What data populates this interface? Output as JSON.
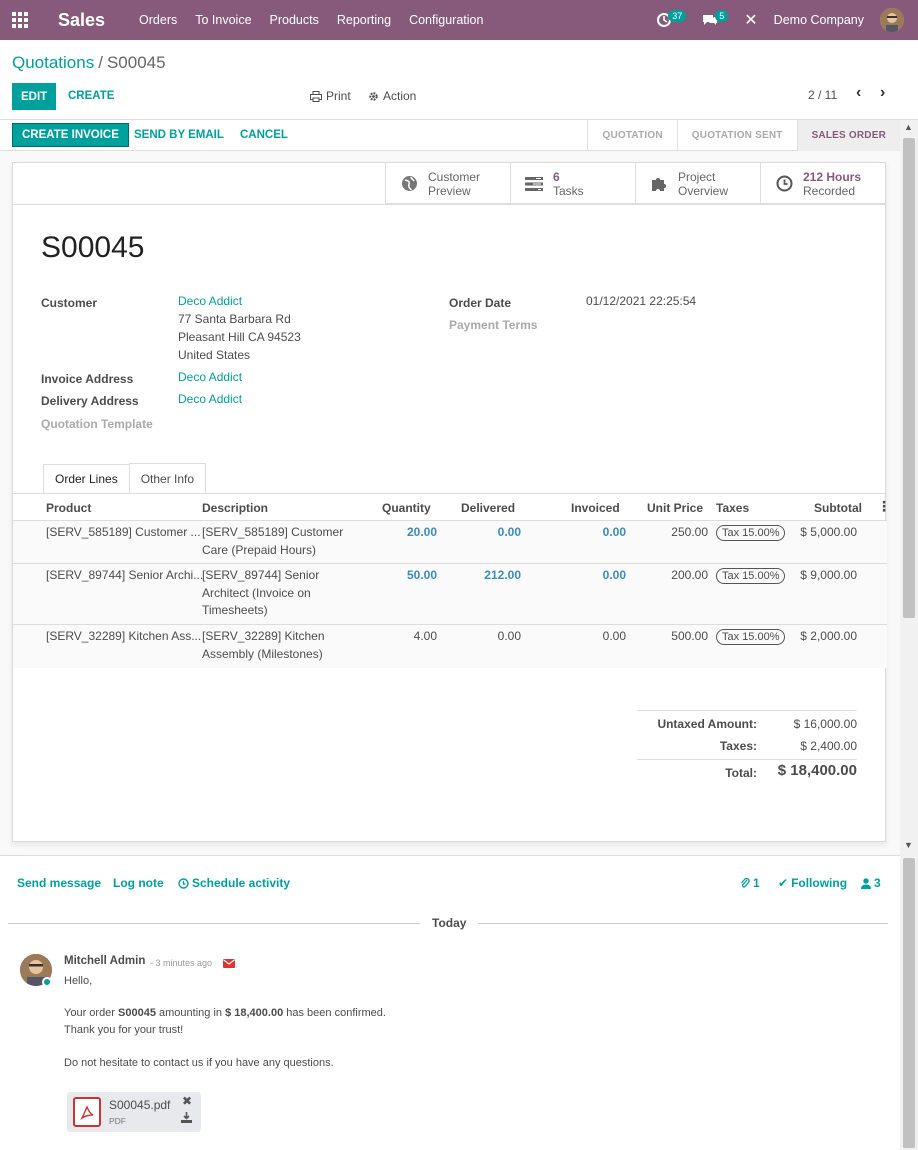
{
  "topbar": {
    "app_name": "Sales",
    "menu": [
      "Orders",
      "To Invoice",
      "Products",
      "Reporting",
      "Configuration"
    ],
    "activity_count": "37",
    "message_count": "5",
    "company": "Demo Company",
    "color": "#875a7b"
  },
  "control_panel": {
    "breadcrumb_parent": "Quotations",
    "breadcrumb_sep": "/",
    "breadcrumb_current": "S00045",
    "edit_label": "EDIT",
    "create_label": "CREATE",
    "print_label": "Print",
    "action_label": "Action",
    "pager": "2 / 11"
  },
  "statusbar": {
    "create_invoice": "CREATE INVOICE",
    "send_by_email": "SEND BY EMAIL",
    "cancel": "CANCEL",
    "stages": [
      "QUOTATION",
      "QUOTATION SENT",
      "SALES ORDER"
    ],
    "active_stage": "SALES ORDER"
  },
  "smart_buttons": [
    {
      "icon": "globe-icon",
      "line1": "Customer",
      "line2": "Preview"
    },
    {
      "icon": "tasks-icon",
      "line1": "6",
      "line2": "Tasks"
    },
    {
      "icon": "puzzle-icon",
      "line1": "Project",
      "line2": "Overview"
    },
    {
      "icon": "clock-icon",
      "line1": "212 Hours",
      "line2": "Recorded"
    }
  ],
  "form": {
    "name": "S00045",
    "customer_label": "Customer",
    "customer_name": "Deco Addict",
    "customer_address": [
      "77 Santa Barbara Rd",
      "Pleasant Hill CA 94523",
      "United States"
    ],
    "invoice_address_label": "Invoice Address",
    "invoice_address": "Deco Addict",
    "delivery_address_label": "Delivery Address",
    "delivery_address": "Deco Addict",
    "quotation_template_label": "Quotation Template",
    "order_date_label": "Order Date",
    "order_date": "01/12/2021 22:25:54",
    "payment_terms_label": "Payment Terms"
  },
  "tabs": [
    "Order Lines",
    "Other Info"
  ],
  "order_lines": {
    "columns": [
      "Product",
      "Description",
      "Quantity",
      "Delivered",
      "Invoiced",
      "Unit Price",
      "Taxes",
      "Subtotal"
    ],
    "rows": [
      {
        "product": "[SERV_585189] Customer ...",
        "description": [
          "[SERV_585189] Customer",
          "Care (Prepaid Hours)"
        ],
        "quantity": "20.00",
        "delivered": "0.00",
        "invoiced": "0.00",
        "unit_price": "250.00",
        "tax": "Tax 15.00%",
        "subtotal": "$ 5,000.00"
      },
      {
        "product": "[SERV_89744] Senior Archi...",
        "description": [
          "[SERV_89744] Senior",
          "Architect (Invoice on",
          "Timesheets)"
        ],
        "quantity": "50.00",
        "delivered": "212.00",
        "invoiced": "0.00",
        "unit_price": "200.00",
        "tax": "Tax 15.00%",
        "subtotal": "$ 9,000.00"
      },
      {
        "product": "[SERV_32289] Kitchen Ass...",
        "description": [
          "[SERV_32289] Kitchen",
          "Assembly (Milestones)"
        ],
        "quantity": "4.00",
        "delivered": "0.00",
        "invoiced": "0.00",
        "unit_price": "500.00",
        "tax": "Tax 15.00%",
        "subtotal": "$ 2,000.00"
      }
    ]
  },
  "totals": {
    "untaxed_label": "Untaxed Amount:",
    "untaxed": "$ 16,000.00",
    "taxes_label": "Taxes:",
    "taxes": "$ 2,400.00",
    "total_label": "Total:",
    "total": "$ 18,400.00"
  },
  "chatter": {
    "send_message": "Send message",
    "log_note": "Log note",
    "schedule_activity": "Schedule activity",
    "attachments_count": "1",
    "following": "Following",
    "followers_count": "3",
    "today": "Today",
    "message": {
      "author": "Mitchell Admin",
      "time": "- 3 minutes ago",
      "hello": "Hello,",
      "line1_pre": "Your order ",
      "line1_order": "S00045",
      "line1_mid": " amounting in ",
      "line1_amount": "$ 18,400.00",
      "line1_post": " has been confirmed.",
      "line2": "Thank you for your trust!",
      "line3": "Do not hesitate to contact us if you have any questions.",
      "attachment_name": "S00045.pdf",
      "attachment_type": "PDF"
    }
  }
}
